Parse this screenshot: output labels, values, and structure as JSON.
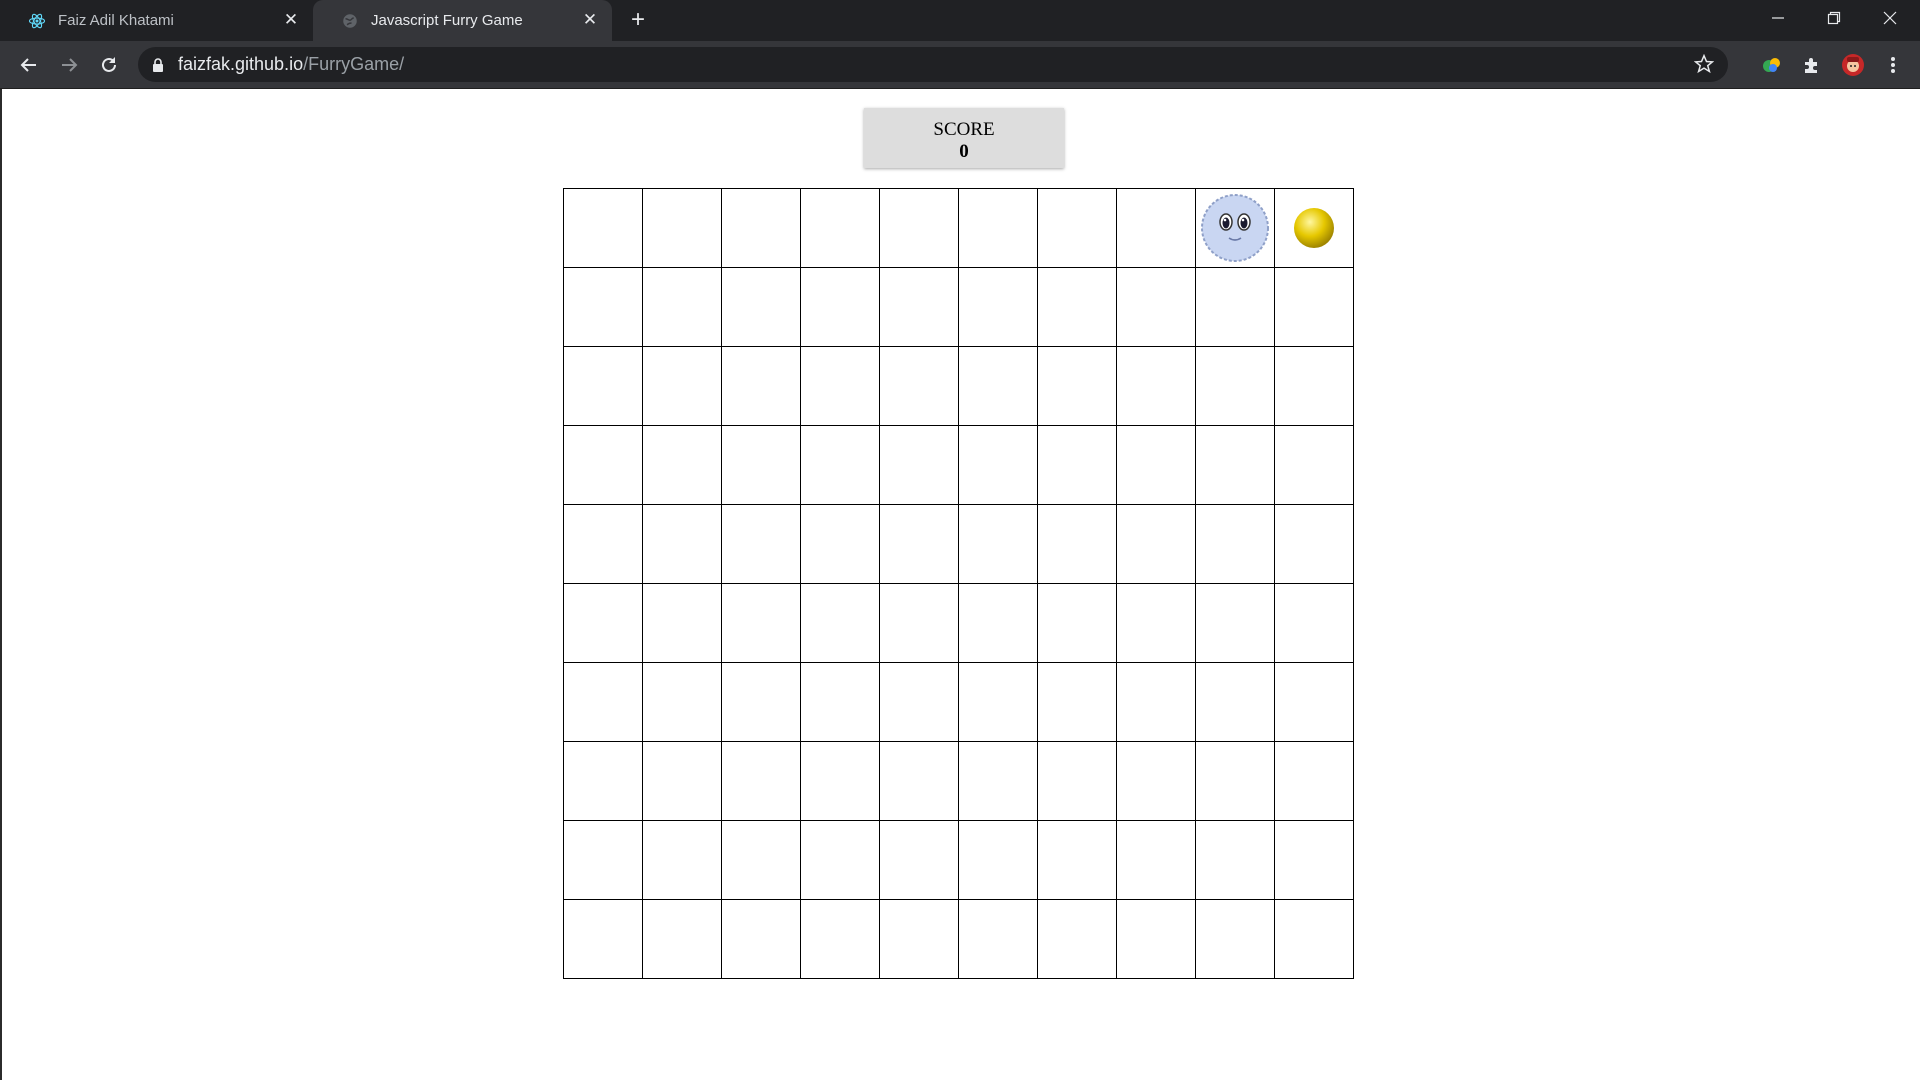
{
  "browser": {
    "tabs": [
      {
        "title": "Faiz Adil Khatami",
        "icon": "react-icon",
        "active": false
      },
      {
        "title": "Javascript Furry Game",
        "icon": "globe-icon",
        "active": true
      }
    ],
    "address": {
      "host": "faizfak.github.io",
      "path": "/FurryGame/"
    }
  },
  "game": {
    "score_label": "SCORE",
    "score_value": "0",
    "grid": {
      "rows": 10,
      "cols": 10
    },
    "furry_position": {
      "row": 0,
      "col": 8
    },
    "coin_position": {
      "row": 0,
      "col": 9
    },
    "colors": {
      "furry_body": "#c9d6f2",
      "coin": "#e6c800",
      "score_bg": "#dddddd"
    }
  }
}
